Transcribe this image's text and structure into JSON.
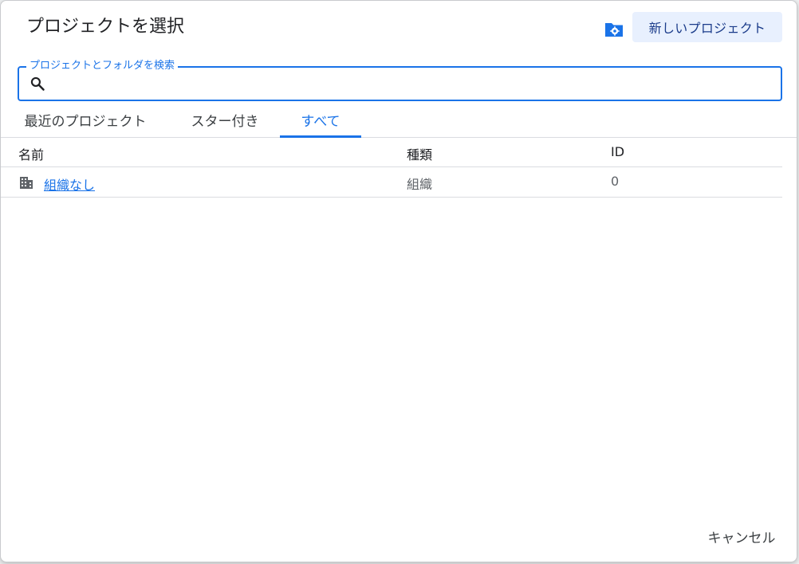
{
  "dialog": {
    "title": "プロジェクトを選択",
    "new_project_label": "新しいプロジェクト",
    "manage_icon": "folder-settings-icon"
  },
  "search": {
    "label": "プロジェクトとフォルダを検索",
    "value": "",
    "icon": "search-icon"
  },
  "tabs": [
    {
      "label": "最近のプロジェクト",
      "active": false
    },
    {
      "label": "スター付き",
      "active": false
    },
    {
      "label": "すべて",
      "active": true
    }
  ],
  "table": {
    "columns": [
      "名前",
      "種類",
      "ID"
    ],
    "rows": [
      {
        "icon": "organization-icon",
        "name": "組織なし",
        "type": "組織",
        "id": "0"
      }
    ]
  },
  "footer": {
    "cancel_label": "キャンセル"
  },
  "colors": {
    "accent": "#1a73e8",
    "button_bg": "#e8f0fe",
    "divider": "#dadce0"
  }
}
